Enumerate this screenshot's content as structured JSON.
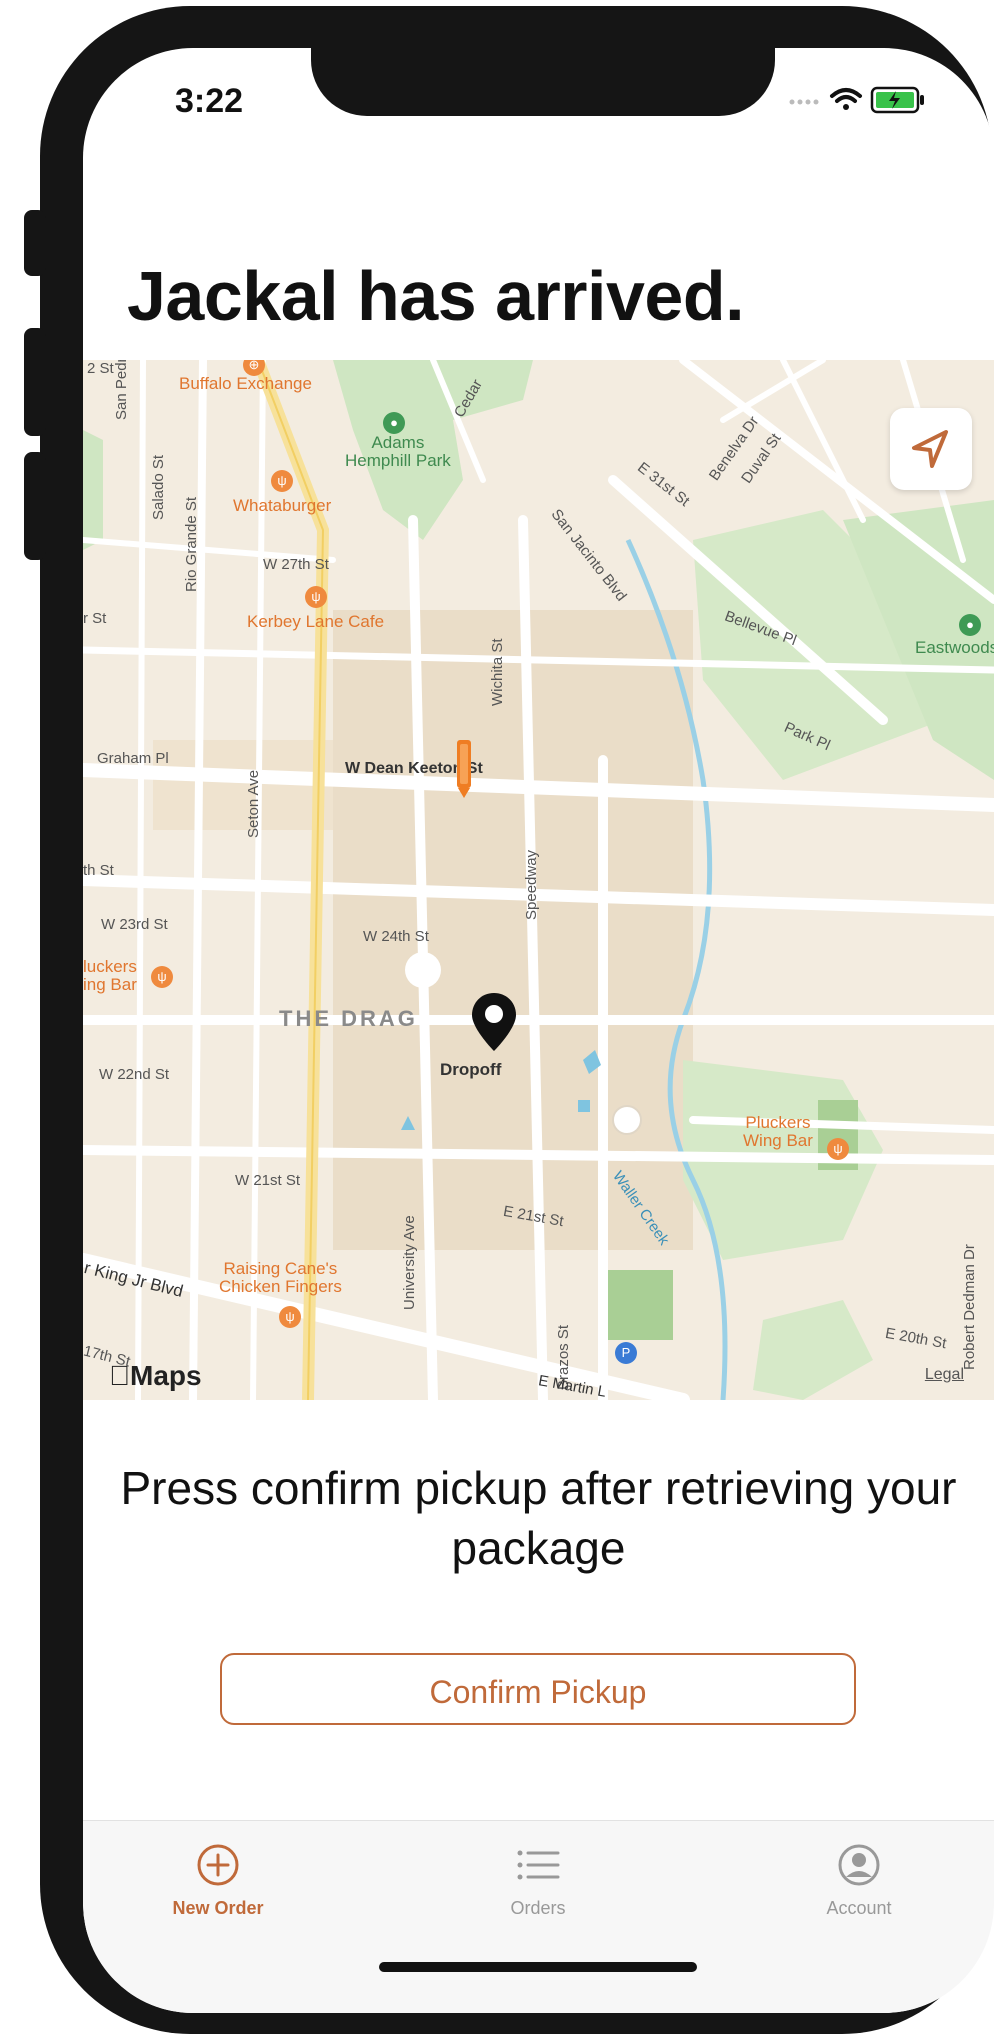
{
  "status": {
    "time": "3:22"
  },
  "header": {
    "title": "Jackal has arrived."
  },
  "map": {
    "labels": {
      "buffalo_exchange": "Buffalo Exchange",
      "adams_park": "Adams\nHemphill Park",
      "whataburger": "Whataburger",
      "kerbey": "Kerbey Lane Cafe",
      "w27": "W 27th St",
      "dean_keeton": "W Dean Keeton St",
      "w24": "W 24th St",
      "w23": "W 23rd St",
      "w22": "W 22nd St",
      "w21": "W 21st St",
      "e21": "E 21st St",
      "e20": "E 20th St",
      "graham": "Graham Pl",
      "seton": "Seton Ave",
      "rio": "Rio Grande St",
      "salado": "Salado St",
      "san_pedro": "San Pedro St",
      "wichita": "Wichita St",
      "speedway": "Speedway",
      "university": "University Ave",
      "brazos": "Brazos St",
      "san_jacinto": "San Jacinto Blvd",
      "bellevue": "Bellevue Pl",
      "park_pl": "Park Pl",
      "duval": "Duval St",
      "benelva": "Benelva Dr",
      "e31": "E 31st St",
      "cedar": "Cedar",
      "eastwoods": "Eastwoods",
      "the_drag": "THE DRAG",
      "pluckers_left": "luckers\ning Bar",
      "pluckers_right": "Pluckers\nWing Bar",
      "raising_canes": "Raising Cane's\nChicken Fingers",
      "mlk": "r King Jr Blvd",
      "waller": "Waller Creek",
      "robert_dedman": "Robert Dedman Dr",
      "e_martin": "E Martin L",
      "w17": "17th St",
      "th_st": "th St",
      "r_st": "r St",
      "st_2": "2 St",
      "dropoff": "Dropoff"
    },
    "logo": "Maps",
    "legal": "Legal"
  },
  "instruction": "Press confirm pickup after retrieving your package",
  "confirm_button": {
    "label": "Confirm Pickup"
  },
  "tabs": [
    {
      "label": "New Order"
    },
    {
      "label": "Orders"
    },
    {
      "label": "Account"
    }
  ],
  "colors": {
    "accent": "#c06a3a",
    "map_bg": "#f3ece0",
    "poi": "#ef8a3e",
    "park": "#cfe6c2"
  }
}
